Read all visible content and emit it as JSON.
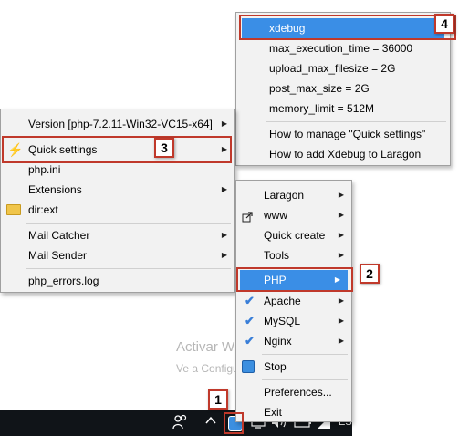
{
  "menus": {
    "top": {
      "items": [
        {
          "label": "xdebug"
        },
        {
          "label": "max_execution_time = 36000"
        },
        {
          "label": "upload_max_filesize = 2G"
        },
        {
          "label": "post_max_size = 2G"
        },
        {
          "label": "memory_limit = 512M"
        },
        {
          "label": "How to manage \"Quick settings\""
        },
        {
          "label": "How to add Xdebug to Laragon"
        }
      ]
    },
    "php": {
      "items": [
        {
          "label": "Version [php-7.2.11-Win32-VC15-x64]"
        },
        {
          "label": "Quick settings"
        },
        {
          "label": "php.ini"
        },
        {
          "label": "Extensions"
        },
        {
          "label": "dir:ext"
        },
        {
          "label": "Mail Catcher"
        },
        {
          "label": "Mail Sender"
        },
        {
          "label": "php_errors.log"
        }
      ]
    },
    "main": {
      "items": [
        {
          "label": "Laragon"
        },
        {
          "label": "www"
        },
        {
          "label": "Quick create"
        },
        {
          "label": "Tools"
        },
        {
          "label": "PHP"
        },
        {
          "label": "Apache"
        },
        {
          "label": "MySQL"
        },
        {
          "label": "Nginx"
        },
        {
          "label": "Stop"
        },
        {
          "label": "Preferences..."
        },
        {
          "label": "Exit"
        }
      ]
    }
  },
  "callouts": [
    "1",
    "2",
    "3",
    "4"
  ],
  "watermark": {
    "line1": "Activar Windows",
    "line2": "Ve a Configuración para activ"
  },
  "taskbar": {
    "lang": "ES"
  },
  "colors": {
    "highlight": "#3a8ee6",
    "callout": "#c0392b",
    "check": "#3a7fd8",
    "taskbar": "#101418"
  }
}
